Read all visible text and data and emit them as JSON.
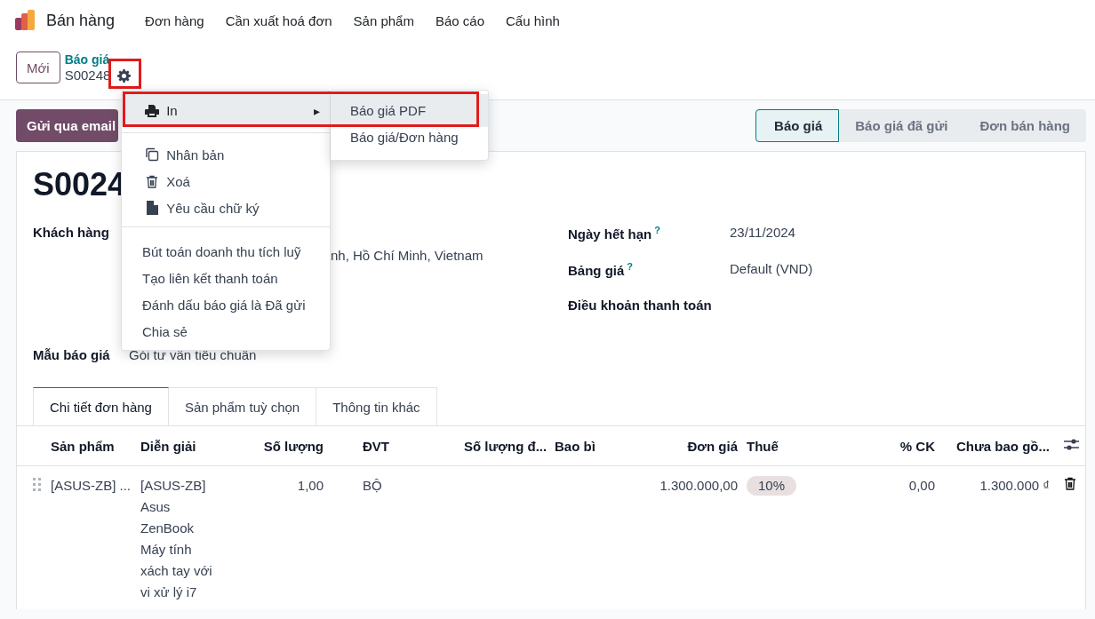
{
  "navbar": {
    "app": "Bán hàng",
    "menus": [
      "Đơn hàng",
      "Cần xuất hoá đơn",
      "Sản phẩm",
      "Báo cáo",
      "Cấu hình"
    ]
  },
  "control_panel": {
    "new_button": "Mới",
    "breadcrumb": "Báo giá",
    "record": "S00248",
    "gear_highlighted": true
  },
  "action_menu": {
    "groups": [
      [
        {
          "kind": "submenu",
          "label": "In",
          "caret": "▸",
          "highlighted": true,
          "expanded": true
        }
      ],
      [
        {
          "kind": "action",
          "label": "Nhân bản"
        },
        {
          "kind": "action",
          "label": "Xoá"
        },
        {
          "kind": "action",
          "label": "Yêu cầu chữ ký"
        }
      ],
      [
        {
          "kind": "plain",
          "label": "Bút toán doanh thu tích luỹ"
        },
        {
          "kind": "plain",
          "label": "Tạo liên kết thanh toán"
        },
        {
          "kind": "plain",
          "label": "Đánh dấu báo giá là Đã gửi"
        },
        {
          "kind": "plain",
          "label": "Chia sẻ"
        }
      ]
    ],
    "submenu": [
      {
        "label": "Báo giá PDF",
        "active": true
      },
      {
        "label": "Báo giá/Đơn hàng",
        "active": false
      }
    ]
  },
  "buttons": [
    "Gửi qua email"
  ],
  "status_stages": [
    {
      "label": "Báo giá",
      "selected": true
    },
    {
      "label": "Báo giá đã gửi",
      "selected": false
    },
    {
      "label": "Đơn bán hàng",
      "selected": false
    }
  ],
  "sheet": {
    "title": "S0024",
    "left_fields": [
      {
        "label": "Khách hàng",
        "value": "nh, Hồ Chí Minh, Vietnam"
      }
    ],
    "right_fields": [
      {
        "label": "Ngày hết hạn",
        "help": "?",
        "value": "23/11/2024"
      },
      {
        "label": "Bảng giá",
        "help": "?",
        "value": "Default (VND)"
      },
      {
        "label": "Điều khoản thanh toán"
      }
    ],
    "template_field": {
      "label": "Mẫu báo giá",
      "value": "Gói tư vấn tiêu chuẩn"
    }
  },
  "tabs": [
    {
      "label": "Chi tiết đơn hàng",
      "selected": true
    },
    {
      "label": "Sản phẩm tuỳ chọn",
      "selected": false
    },
    {
      "label": "Thông tin khác",
      "selected": false
    }
  ],
  "table": {
    "columns": [
      "Sản phẩm",
      "Diễn giải",
      "Số lượng",
      "ĐVT",
      "Số lượng đ...",
      "Bao bì",
      "Đơn giá",
      "Thuế",
      "% CK",
      "Chưa bao gồ..."
    ],
    "rows": [
      {
        "product": "[ASUS-ZB] ...",
        "description": "[ASUS-ZB]\nAsus\nZenBook\nMáy tính\nxách tay với\nvi xử lý i7",
        "quantity": "1,00",
        "uom": "BỘ",
        "delivered": "",
        "packaging": "",
        "price": "1.300.000,00",
        "tax": "10%",
        "discount": "0,00",
        "subtotal": "1.300.000 ₫"
      }
    ]
  }
}
